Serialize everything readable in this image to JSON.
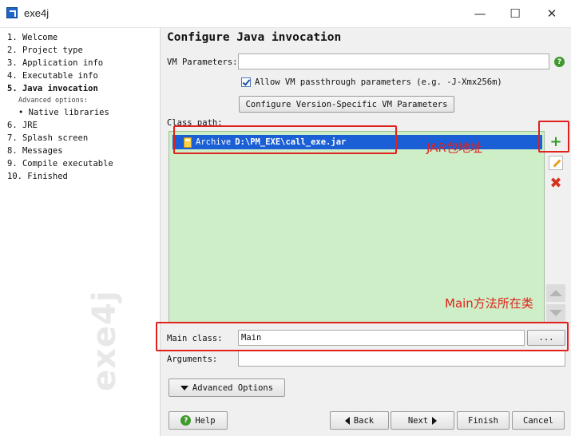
{
  "window": {
    "title": "exe4j",
    "minimize": "—",
    "maximize": "☐",
    "close": "✕"
  },
  "steps": [
    {
      "label": "1.  Welcome"
    },
    {
      "label": "2.  Project type"
    },
    {
      "label": "3.  Application info"
    },
    {
      "label": "4.  Executable info"
    },
    {
      "label": "5.  Java invocation"
    },
    {
      "label": "Advanced options:"
    },
    {
      "label": "• Native libraries"
    },
    {
      "label": "6.  JRE"
    },
    {
      "label": "7.  Splash screen"
    },
    {
      "label": "8.  Messages"
    },
    {
      "label": "9.  Compile executable"
    },
    {
      "label": "10.  Finished"
    }
  ],
  "watermark": "exe4j",
  "page": {
    "heading": "Configure Java invocation",
    "vm_params_label": "VM Parameters:",
    "vm_params_value": "",
    "passthrough_label": "Allow VM passthrough parameters (e.g. -J-Xmx256m)",
    "passthrough_checked": true,
    "configure_vm_button": "Configure Version-Specific VM Parameters",
    "classpath_label": "Class path:",
    "classpath_entries": [
      {
        "type": "Archive",
        "path": "D:\\PM_EXE\\call_exe.jar"
      }
    ],
    "main_class_label": "Main class:",
    "main_class_value": "Main",
    "browse_button": "...",
    "arguments_label": "Arguments:",
    "arguments_value": "",
    "advanced_options_button": "Advanced Options"
  },
  "annotations": {
    "jar": "JAR包地址",
    "main": "Main方法所在类",
    "color": "#e0211c"
  },
  "footer": {
    "help": "Help",
    "back": "Back",
    "next": "Next",
    "finish": "Finish",
    "cancel": "Cancel"
  },
  "icons": {
    "help": "?",
    "add": "+",
    "remove": "✖"
  },
  "colors": {
    "selection": "#1b5fd6",
    "classpath_bg": "#cdeec7",
    "accent_green": "#2f9e23"
  }
}
